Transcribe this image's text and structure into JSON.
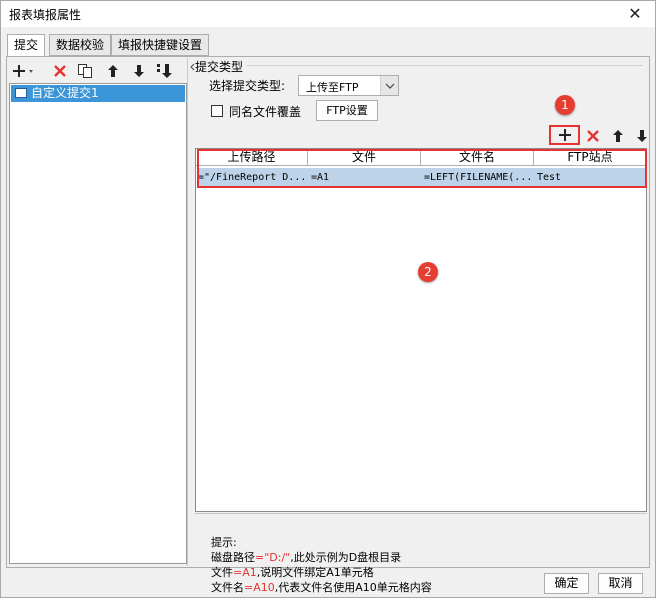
{
  "dialog": {
    "title": "报表填报属性",
    "close_glyph": "✕"
  },
  "tabs": [
    {
      "label": "提交",
      "active": true
    },
    {
      "label": "数据校验",
      "active": false
    },
    {
      "label": "填报快捷键设置",
      "active": false
    }
  ],
  "left_panel": {
    "toolbar": [
      "add-dropdown-icon",
      "delete-icon",
      "copy-icon",
      "move-up-icon",
      "move-down-icon",
      "move-bottom-icon"
    ],
    "items": [
      {
        "label": "自定义提交1",
        "selected": true
      }
    ]
  },
  "submit_type": {
    "group_title": "提交类型",
    "select_label": "选择提交类型:",
    "select_value": "上传至FTP",
    "overwrite_label": "同名文件覆盖",
    "overwrite_checked": false,
    "ftp_settings_button": "FTP设置"
  },
  "grid_toolbar": [
    "add-icon",
    "delete-icon",
    "move-up-icon",
    "move-down-icon"
  ],
  "badges": {
    "one": "1",
    "two": "2"
  },
  "table": {
    "columns": [
      "上传路径",
      "文件",
      "文件名",
      "FTP站点"
    ],
    "rows": [
      [
        "=\"/FineReport D...",
        "=A1",
        "=LEFT(FILENAME(...",
        "Test"
      ]
    ]
  },
  "hint": {
    "title": "提示:",
    "line1_prefix": "磁盘路径",
    "line1_red": "=\"D:/\"",
    "line1_suffix": ",此处示例为D盘根目录",
    "line2_prefix": "文件",
    "line2_red": "=A1",
    "line2_suffix": ",说明文件绑定A1单元格",
    "line3_prefix": "文件名",
    "line3_red": "=A10",
    "line3_suffix": ",代表文件名使用A10单元格内容"
  },
  "footer": {
    "ok": "确定",
    "cancel": "取消"
  },
  "colors": {
    "accent_red": "#e53333",
    "selection_blue": "#3c95d6",
    "row_highlight": "#bcd3e9"
  }
}
